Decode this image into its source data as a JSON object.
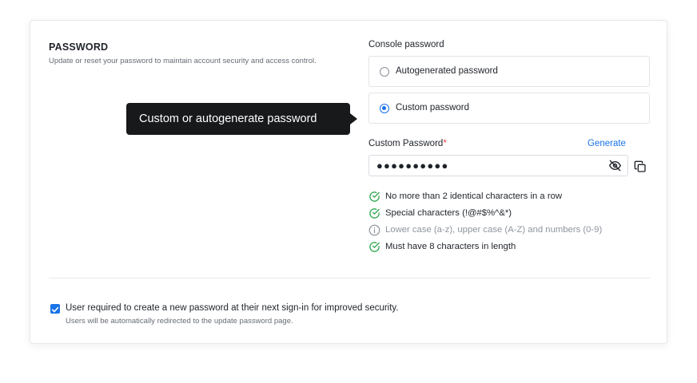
{
  "section": {
    "title": "PASSWORD",
    "description": "Update or reset your password to maintain account security and access control."
  },
  "tooltip": {
    "text": "Custom or autogenerate password"
  },
  "console_password": {
    "label": "Console password",
    "options": [
      {
        "label": "Autogenerated password",
        "selected": false
      },
      {
        "label": "Custom password",
        "selected": true
      }
    ]
  },
  "custom_password": {
    "label": "Custom Password",
    "required_mark": "*",
    "generate_label": "Generate",
    "value": "●●●●●●●●●●",
    "eye_icon": "eye-off-icon",
    "copy_icon": "copy-icon"
  },
  "rules": [
    {
      "text": "No more than 2 identical characters in a row",
      "status": "passed",
      "icon": "check-circle-icon"
    },
    {
      "text": "Special characters (!@#$%^&*)",
      "status": "passed",
      "icon": "check-circle-icon"
    },
    {
      "text": "Lower case (a-z), upper case (A-Z) and numbers (0-9)",
      "status": "info",
      "icon": "info-circle-icon"
    },
    {
      "text": "Must have 8 characters in length",
      "status": "passed",
      "icon": "check-circle-icon"
    }
  ],
  "reset_requirement": {
    "checked": true,
    "label": "User required to create a new password at their next sign-in for improved security.",
    "sublabel": "Users will be automatically redirected to the update password page."
  },
  "colors": {
    "accent": "#1a73e8",
    "success": "#34a853",
    "muted": "#8f959e",
    "tooltip_bg": "#18191b",
    "required": "#e5484d"
  }
}
